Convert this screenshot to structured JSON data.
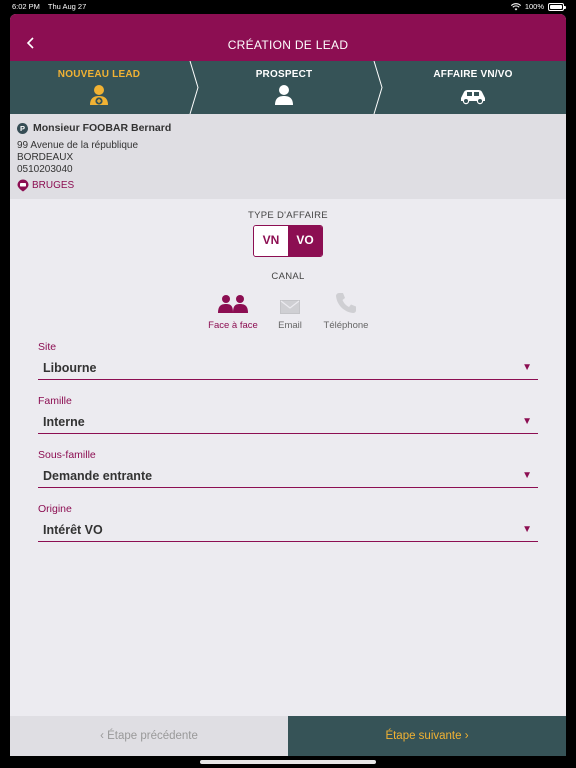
{
  "status_bar": {
    "time": "6:02 PM",
    "date": "Thu Aug 27",
    "battery": "100%"
  },
  "header": {
    "title": "CRÉATION DE LEAD"
  },
  "steps": [
    {
      "label": "NOUVEAU LEAD",
      "icon": "add-person-icon",
      "active": true
    },
    {
      "label": "PROSPECT",
      "icon": "person-icon",
      "active": false
    },
    {
      "label": "AFFAIRE VN/VO",
      "icon": "car-icon",
      "active": false
    }
  ],
  "contact": {
    "badge": "P",
    "name": "Monsieur FOOBAR Bernard",
    "address": "99 Avenue de la république",
    "city": "BORDEAUX",
    "phone": "0510203040",
    "site": "BRUGES"
  },
  "type_affaire": {
    "label": "TYPE D'AFFAIRE",
    "options": [
      "VN",
      "VO"
    ],
    "selected": "VO"
  },
  "canal": {
    "label": "CANAL",
    "options": [
      {
        "label": "Face à face",
        "icon": "face-to-face-icon",
        "selected": true
      },
      {
        "label": "Email",
        "icon": "email-icon",
        "selected": false
      },
      {
        "label": "Téléphone",
        "icon": "phone-icon",
        "selected": false
      }
    ]
  },
  "fields": [
    {
      "label": "Site",
      "value": "Libourne"
    },
    {
      "label": "Famille",
      "value": "Interne"
    },
    {
      "label": "Sous-famille",
      "value": "Demande entrante"
    },
    {
      "label": "Origine",
      "value": "Intérêt VO"
    }
  ],
  "footer": {
    "prev": "‹ Étape précédente",
    "next": "Étape suivante ›"
  },
  "colors": {
    "primary": "#8c0e52",
    "dark": "#365357",
    "accent": "#f1b233",
    "background": "#ecebf0"
  }
}
